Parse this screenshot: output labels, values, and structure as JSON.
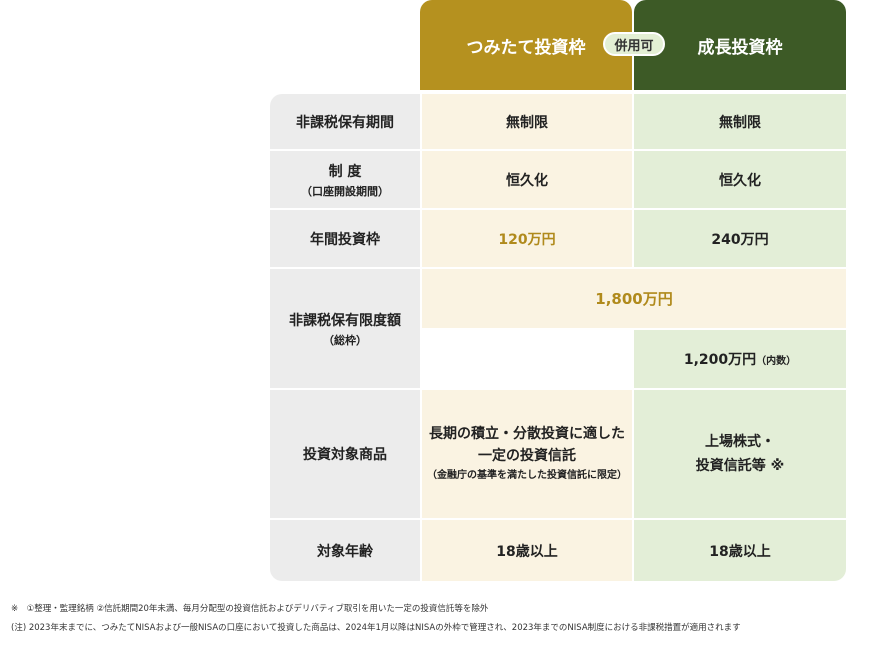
{
  "header": {
    "tsumitate": "つみたて投資枠",
    "badge": "併用可",
    "seicho": "成長投資枠"
  },
  "rows": {
    "period": {
      "label": "非課税保有期間",
      "tsumitate": "無制限",
      "seicho": "無制限"
    },
    "system": {
      "label": "制 度",
      "label_sub": "（口座開設期間）",
      "tsumitate": "恒久化",
      "seicho": "恒久化"
    },
    "annual": {
      "label": "年間投資枠",
      "tsumitate": "120万円",
      "seicho": "240万円"
    },
    "limit": {
      "label": "非課税保有限度額",
      "label_sub": "（総枠）",
      "total": "1,800万円",
      "seicho": "1,200万円",
      "seicho_note": "（内数）"
    },
    "products": {
      "label": "投資対象商品",
      "tsumitate_line1": "長期の積立・分散投資に適した",
      "tsumitate_line2": "一定の投資信託",
      "tsumitate_sub": "（金融庁の基準を満たした投資信託に限定）",
      "seicho_line1": "上場株式・",
      "seicho_line2": "投資信託等 ※"
    },
    "age": {
      "label": "対象年齢",
      "tsumitate": "18歳以上",
      "seicho": "18歳以上"
    }
  },
  "notes": {
    "note1": "※　①整理・監理銘柄 ②信託期間20年未満、毎月分配型の投資信託およびデリバティブ取引を用いた一定の投資信託等を除外",
    "note2": "(注) 2023年末までに、つみたてNISAおよび一般NISAの口座において投資した商品は、2024年1月以降はNISAの外枠で管理され、2023年までのNISA制度における非課税措置が適用されます"
  },
  "colors": {
    "tsumitate_header": "#b5911f",
    "seicho_header": "#3d5a26",
    "tsumitate_bg": "#faf3e2",
    "seicho_bg": "#e3eed7",
    "label_bg": "#ececec",
    "accent_gold": "#b08a1c"
  }
}
